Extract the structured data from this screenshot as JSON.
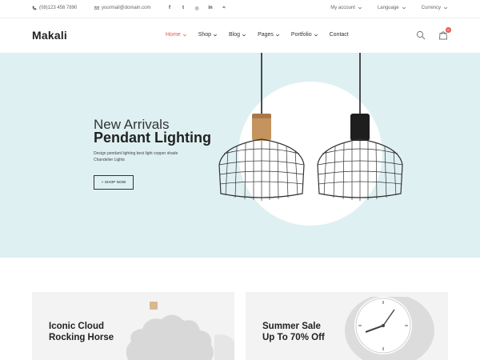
{
  "topbar": {
    "phone": "(08)123 456 7890",
    "email": "yourmail@domain.com",
    "social": [
      "facebook-icon",
      "twitter-icon",
      "instagram-icon",
      "linkedin-icon",
      "rss-icon"
    ],
    "social_glyphs": [
      "f",
      "t",
      "◎",
      "in",
      "≈"
    ],
    "account": "My account",
    "language": "Language",
    "currency": "Currency"
  },
  "header": {
    "logo": "Makali",
    "nav": [
      {
        "label": "Home",
        "active": true,
        "dropdown": true
      },
      {
        "label": "Shop",
        "active": false,
        "dropdown": true
      },
      {
        "label": "Blog",
        "active": false,
        "dropdown": true
      },
      {
        "label": "Pages",
        "active": false,
        "dropdown": true
      },
      {
        "label": "Portfolio",
        "active": false,
        "dropdown": true
      },
      {
        "label": "Contact",
        "active": false,
        "dropdown": false
      }
    ],
    "cart_count": "0",
    "accent": "#e8584e"
  },
  "hero": {
    "subtitle": "New Arrivals",
    "title": "Pendant Lighting",
    "description": "Design pendant lighting best light copper shade Chandelier Lights",
    "button": "+ SHOP NOW",
    "background": "#dff0f2"
  },
  "banners": [
    {
      "line1": "Iconic Cloud",
      "line2": "Rocking Horse"
    },
    {
      "line1": "Summer Sale",
      "line2": "Up To 70% Off"
    }
  ]
}
